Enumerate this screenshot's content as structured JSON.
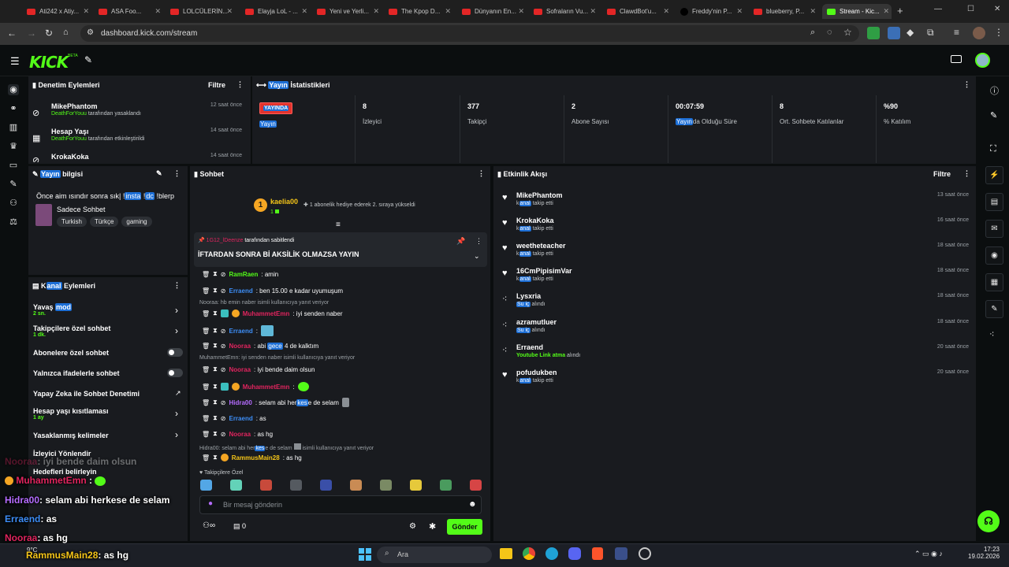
{
  "browser": {
    "tabs": [
      {
        "label": "Ati242 x Atiy..."
      },
      {
        "label": "ASA Foo..."
      },
      {
        "label": "LOLCÜLERİN..."
      },
      {
        "label": "Elayja LoL - ..."
      },
      {
        "label": "Yeni ve Yerli..."
      },
      {
        "label": "The Kpop D..."
      },
      {
        "label": "Dünyanın En..."
      },
      {
        "label": "Sofraların Vu..."
      },
      {
        "label": "ClawdBot'u..."
      },
      {
        "label": "Freddy'nin P..."
      },
      {
        "label": "blueberry, P..."
      },
      {
        "label": "Stream - Kic..."
      }
    ],
    "url": "dashboard.kick.com/stream"
  },
  "header": {
    "logo": "KICK",
    "beta": "BETA"
  },
  "moderation": {
    "title": "Denetim Eylemleri",
    "filter": "Filtre",
    "items": [
      {
        "name": "MikePhantom",
        "actor": "DeathForYouu",
        "desc": "tarafından yasaklandı",
        "time": "12 saat önce",
        "icon": "ban-icon"
      },
      {
        "name": "Hesap Yaşı",
        "actor": "DeathForYouu",
        "desc": "tarafından etkinleştirildi",
        "time": "14 saat önce",
        "icon": "calendar-icon"
      },
      {
        "name": "KrokaKoka",
        "actor": "",
        "desc": "",
        "time": "14 saat önce",
        "icon": "ban-icon"
      }
    ]
  },
  "stats": {
    "title_hl": "Yayın",
    "title_rest": " İstatistikleri",
    "live_badge": "YAYINDA",
    "live_label": "Yayın",
    "cells": [
      {
        "value": "8",
        "label": "İzleyici"
      },
      {
        "value": "377",
        "label": "Takipçi"
      },
      {
        "value": "2",
        "label": "Abone Sayısı"
      },
      {
        "value": "00:07:59",
        "label_hl": "Yayın",
        "label": "da Olduğu Süre"
      },
      {
        "value": "8",
        "label": "Ort. Sohbete Katılanlar"
      },
      {
        "value": "%90",
        "label": "% Katılım"
      }
    ]
  },
  "streaminfo": {
    "title_hl": "Yayın",
    "title_rest": " bilgisi",
    "stream_title_a": "Önce aim ısındır sonra sık| !",
    "stream_title_hl1": "insta",
    "stream_title_b": " !",
    "stream_title_hl2": "dc",
    "stream_title_c": " !blerp",
    "category": "Sadece Sohbet",
    "tags": [
      "Turkish",
      "Türkçe",
      "gaming"
    ]
  },
  "channel": {
    "title_a": "K",
    "title_hl": "anal",
    "title_b": " Eylemleri",
    "items": [
      {
        "label_a": "Yavaş ",
        "label_hl": "mod",
        "sub": "2 sn.",
        "control": "chevron"
      },
      {
        "label_a": "Takipçilere özel sohbet",
        "sub": "1 dk.",
        "control": "chevron"
      },
      {
        "label_a": "Abonelere özel sohbet",
        "control": "toggle"
      },
      {
        "label_a": "Yalnızca ifadelerle sohbet",
        "control": "toggle"
      },
      {
        "label_a": "Yapay Zeka ile Sohbet Denetimi",
        "control": "external"
      },
      {
        "label_a": "Hesap yaşı kısıtlaması",
        "sub": "1 ay",
        "control": "chevron"
      },
      {
        "label_a": "Yasaklanmış kelimeler",
        "control": "chevron"
      },
      {
        "label_a": "İzleyici Yönlendir",
        "control": "none"
      },
      {
        "label_a": "Hedefleri belirleyin",
        "control": "none"
      }
    ]
  },
  "chat": {
    "title": "Sohbet",
    "gift_user": "kaelia00",
    "gift_count": "1",
    "gift_text": "1 abonelik hediye ederek 2. sıraya yükseldi",
    "pinned_by_user": "1G12_lDeenze",
    "pinned_by_text": "tarafından sabitlendi",
    "pinned_message": "İFTARDAN SONRA Bİ AKSİLİK OLMAZSA YAYIN",
    "messages": [
      {
        "user": "RamRaen",
        "color": "#53fc18",
        "text": ": amin"
      },
      {
        "user": "Erraend",
        "color": "#3d8ef7",
        "text": ": ben 15.00 e kadar uyumuşum"
      },
      {
        "reply": "Nooraa: hb emin naber isimli kullanıcıya yanıt veriyor"
      },
      {
        "user": "MuhammetEmn",
        "color": "#e0245e",
        "text": ": iyi senden naber"
      },
      {
        "user": "Erraend",
        "color": "#3d8ef7",
        "text": ":"
      },
      {
        "user": "Nooraa",
        "color": "#e0245e",
        "text_a": ": abi ",
        "text_hl": "gece",
        "text_b": " 4 de kalktım"
      },
      {
        "reply": "MuhammetEmn: iyi senden naber isimli kullanıcıya yanıt veriyor"
      },
      {
        "user": "Nooraa",
        "color": "#e0245e",
        "text": ": iyi bende daim olsun"
      },
      {
        "user": "MuhammetEmn",
        "color": "#e0245e",
        "text": ":"
      },
      {
        "user": "Hidra00",
        "color": "#b56cff",
        "text_a": ": selam abi her",
        "text_hl": "kes",
        "text_b": "e de selam"
      },
      {
        "user": "Erraend",
        "color": "#3d8ef7",
        "text": ": as"
      },
      {
        "user": "Nooraa",
        "color": "#e0245e",
        "text": ": as hg"
      },
      {
        "reply_a": "Hidra00: selam abi her",
        "reply_hl": "kes",
        "reply_b": "e de selam",
        "reply_c": "isimli kullanıcıya yanıt veriyor"
      },
      {
        "user": "RammusMain28",
        "color": "#f5c518",
        "text": ": as hg"
      }
    ],
    "followers_only": "Takipçilere Özel",
    "input_placeholder": "Bir mesaj gönderin",
    "points": "0",
    "send": "Gönder"
  },
  "activity": {
    "title": "Etkinlik Akışı",
    "filter": "Filtre",
    "items": [
      {
        "name": "MikePhantom",
        "desc_a": "k",
        "desc_hl": "anal",
        "desc_b": " takip etti",
        "time": "13 saat önce",
        "icon": "heart-icon"
      },
      {
        "name": "KrokaKoka",
        "desc_a": "k",
        "desc_hl": "anal",
        "desc_b": " takip etti",
        "time": "16 saat önce",
        "icon": "heart-icon"
      },
      {
        "name": "weetheteacher",
        "desc_a": "k",
        "desc_hl": "anal",
        "desc_b": " takip etti",
        "time": "18 saat önce",
        "icon": "heart-icon"
      },
      {
        "name": "16CmPipisimVar",
        "desc_a": "k",
        "desc_hl": "anal",
        "desc_b": " takip etti",
        "time": "18 saat önce",
        "icon": "heart-icon"
      },
      {
        "name": "Lysxria",
        "desc_a": "",
        "desc_hl": "Su iç",
        "desc_b": " alındı",
        "time": "18 saat önce",
        "icon": "reward-icon"
      },
      {
        "name": "azramutluer",
        "desc_a": "",
        "desc_hl": "Su iç",
        "desc_b": " alındı",
        "time": "18 saat önce",
        "icon": "reward-icon"
      },
      {
        "name": "Erraend",
        "desc_a": "",
        "desc_green": "Youtube Link atma",
        "desc_b": " alındı",
        "time": "20 saat önce",
        "icon": "reward-icon"
      },
      {
        "name": "pofudukben",
        "desc_a": "k",
        "desc_hl": "anal",
        "desc_b": " takip etti",
        "time": "20 saat önce",
        "icon": "heart-icon"
      }
    ]
  },
  "overlay": {
    "lines": [
      {
        "user": "Nooraa",
        "color": "#e0245e",
        "text": ": iyi bende daim olsun"
      },
      {
        "user": "MuhammetEmn",
        "color": "#e0245e",
        "text": ":"
      },
      {
        "user": "Hidra00",
        "color": "#b56cff",
        "text": ": selam abi herkese de selam"
      },
      {
        "user": "Erraend",
        "color": "#3d8ef7",
        "text": ": as"
      },
      {
        "user": "Nooraa",
        "color": "#e0245e",
        "text": ": as hg"
      },
      {
        "user": "RammusMain28",
        "color": "#f5c518",
        "text": ": as hg"
      }
    ]
  },
  "taskbar": {
    "weather": "9°C",
    "search": "Ara",
    "time": "17:23",
    "date": "19.02.2026"
  },
  "colors": {
    "accent": "#53fc18",
    "highlight": "#1d6fd6",
    "panel": "#191b1f",
    "bg": "#0b0e0f"
  }
}
